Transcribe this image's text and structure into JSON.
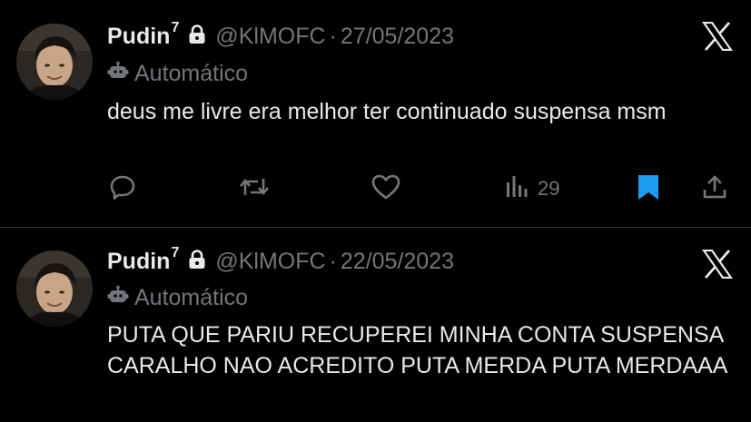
{
  "colors": {
    "background": "#000000",
    "text_primary": "#e7e9ea",
    "text_secondary": "#71767b",
    "bookmark_active": "#1d9bf0",
    "divider": "#2f3336"
  },
  "tweets": [
    {
      "author_name": "Pudin",
      "author_badge": "7",
      "handle": "@KlMOFC",
      "separator": "·",
      "date": "27/05/2023",
      "automated_label": "Automático",
      "text": "deus me livre era melhor ter continuado suspensa msm",
      "icons": {
        "protected": "lock-icon",
        "automated": "robot-icon",
        "platform": "x-logo-icon"
      },
      "actions": {
        "reply": "reply-icon",
        "retweet": "retweet-icon",
        "like": "like-icon",
        "views": "views-icon",
        "views_count": "29",
        "bookmark": "bookmark-icon-filled",
        "share": "share-icon"
      }
    },
    {
      "author_name": "Pudin",
      "author_badge": "7",
      "handle": "@KlMOFC",
      "separator": "·",
      "date": "22/05/2023",
      "automated_label": "Automático",
      "text": "PUTA QUE PARIU RECUPEREI MINHA CONTA SUSPENSA CARALHO NAO ACREDITO PUTA MERDA PUTA MERDAAA",
      "icons": {
        "protected": "lock-icon",
        "automated": "robot-icon",
        "platform": "x-logo-icon"
      }
    }
  ]
}
